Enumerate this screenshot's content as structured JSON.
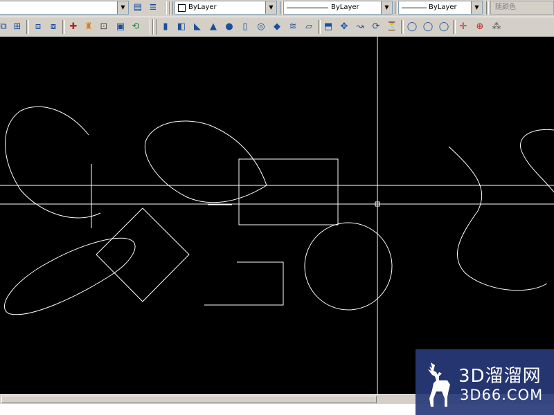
{
  "toolbar_top": {
    "layer_combo_value": "",
    "color_combo_value": "ByLayer",
    "linetype_combo_value": "ByLayer",
    "lineweight_combo_value": "ByLayer",
    "plotstyle_combo_value": "随颜色"
  },
  "toolbar_icons": {
    "left_group": [
      "view-icon",
      "view-icon-2",
      "3d-orbit-icon",
      "camera-icon",
      "ucs-icon",
      "named-views-icon",
      "render-icon",
      "toggle-icon",
      "box-wire-icon",
      "rotate-icon"
    ],
    "solids_group": [
      "box-icon",
      "wedge-icon",
      "cone-icon",
      "sphere-icon",
      "cylinder-icon",
      "torus-icon",
      "pyramid-icon",
      "helix-icon",
      "planar-surface-icon"
    ],
    "modify_group": [
      "extrude-icon",
      "presspull-icon",
      "sweep-icon",
      "revolve-icon",
      "loft-icon"
    ],
    "boolean_group": [
      "union-icon",
      "subtract-icon",
      "intersect-icon"
    ],
    "tail_group": [
      "3d-move-icon",
      "3d-rotate-icon",
      "3d-align-icon"
    ]
  },
  "watermark": {
    "brand_cn": "3D溜溜网",
    "brand_url": "3D66.COM"
  },
  "colors": {
    "canvas": "#000000",
    "toolbar": "#d4d0c8",
    "geometry": "#ffffff",
    "watermark_bg": "#283a78"
  }
}
